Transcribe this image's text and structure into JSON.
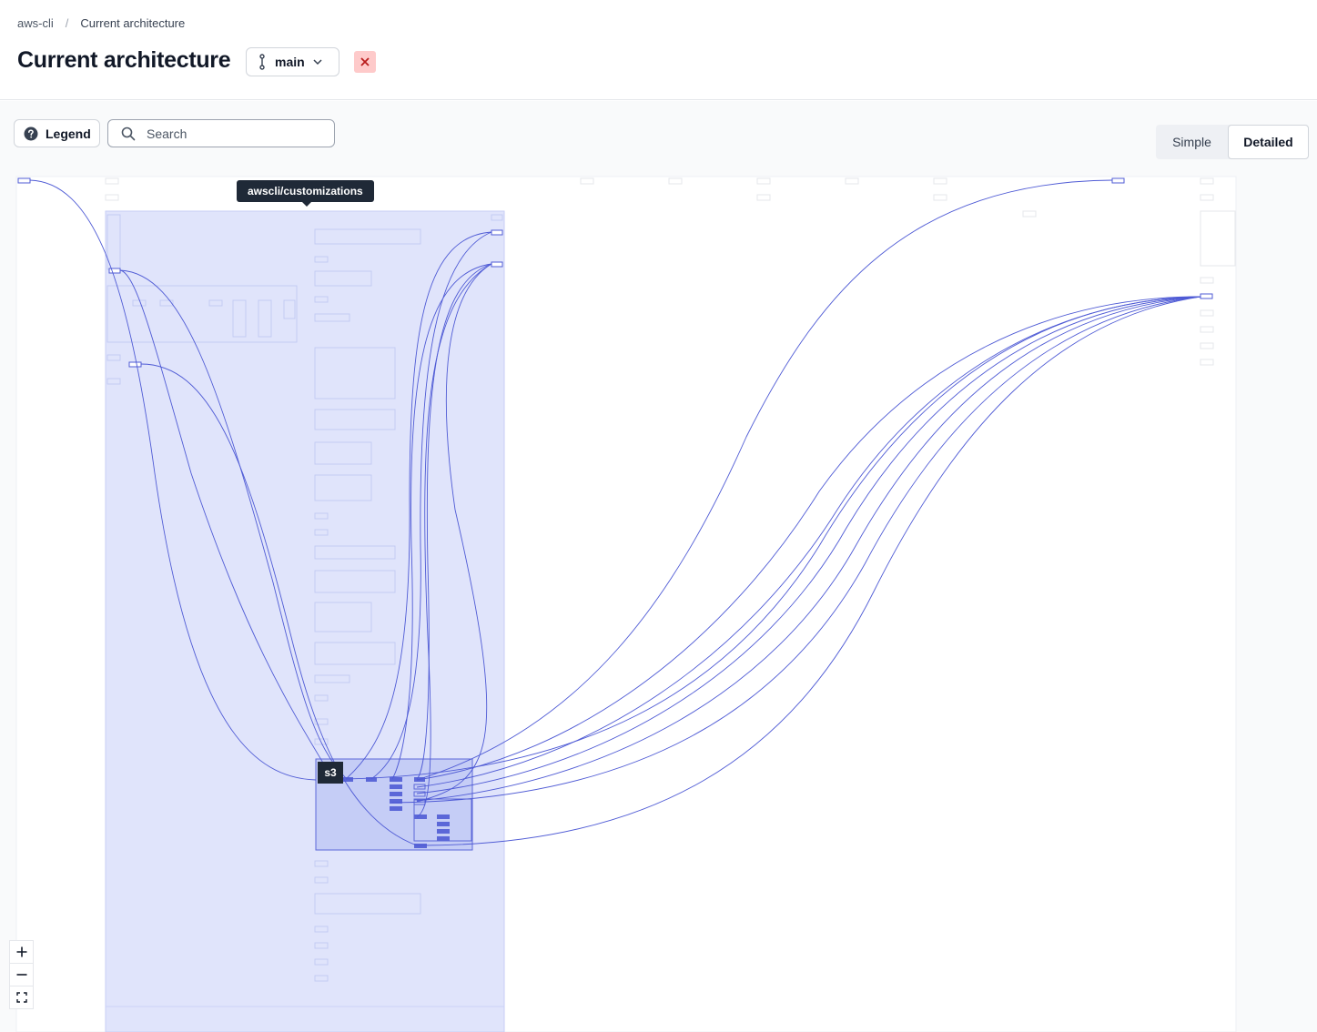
{
  "breadcrumb": {
    "repo": "aws-cli",
    "separator": "/",
    "current": "Current architecture"
  },
  "header": {
    "title": "Current architecture",
    "branch": "main",
    "branch_icon": "git-branch-icon",
    "close_icon": "close-icon",
    "close_color": "#fecaca"
  },
  "toolbar": {
    "legend_label": "Legend",
    "legend_icon": "question-circle-icon",
    "search_placeholder": "Search",
    "search_icon": "search-icon"
  },
  "view_toggle": {
    "options": [
      "Simple",
      "Detailed"
    ],
    "selected": "Detailed"
  },
  "graph": {
    "hovered_module": "awscli/customizations",
    "selected_node": "s3",
    "highlight_color": "#6366f1",
    "region_color": "#e0e7ff",
    "edge_color": "#4f5bd5"
  },
  "zoom": {
    "zoom_in_icon": "plus-icon",
    "zoom_out_icon": "minus-icon",
    "fit_icon": "fit-view-icon"
  }
}
